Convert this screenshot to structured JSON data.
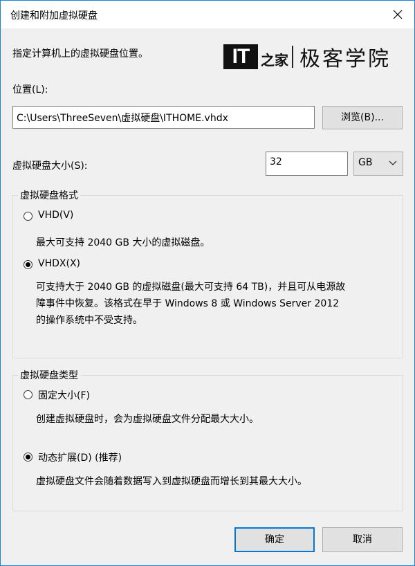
{
  "dialog": {
    "title": "创建和附加虚拟硬盘",
    "close_icon": "close-icon",
    "instruction": "指定计算机上的虚拟硬盘位置。"
  },
  "watermark": {
    "it_text": "IT",
    "glyph": "之家",
    "brand_text": "极客学院"
  },
  "location": {
    "label": "位置(L):",
    "value": "C:\\Users\\ThreeSeven\\虚拟硬盘\\ITHOME.vhdx",
    "browse_label": "浏览(B)..."
  },
  "size": {
    "label": "虚拟硬盘大小(S):",
    "value": "32",
    "unit": "GB"
  },
  "format": {
    "legend": "虚拟硬盘格式",
    "options": [
      {
        "label": "VHD(V)",
        "selected": false,
        "description": "最大可支持 2040 GB 大小的虚拟磁盘。"
      },
      {
        "label": "VHDX(X)",
        "selected": true,
        "description_lines": [
          "可支持大于 2040 GB 的虚拟磁盘(最大可支持 64 TB)，并且可从电源故",
          "障事件中恢复。该格式在早于 Windows 8 或 Windows Server 2012",
          "的操作系统中不受支持。"
        ]
      }
    ]
  },
  "type": {
    "legend": "虚拟硬盘类型",
    "options": [
      {
        "label": "固定大小(F)",
        "selected": false,
        "description": "创建虚拟硬盘时，会为虚拟硬盘文件分配最大大小。"
      },
      {
        "label": "动态扩展(D) (推荐)",
        "selected": true,
        "description": "虚拟硬盘文件会随着数据写入到虚拟硬盘而增长到其最大大小。"
      }
    ]
  },
  "buttons": {
    "ok": "确定",
    "cancel": "取消"
  },
  "colors": {
    "accent": "#0078d7",
    "window_border": "#1883d7",
    "background": "#f0f0f0"
  }
}
